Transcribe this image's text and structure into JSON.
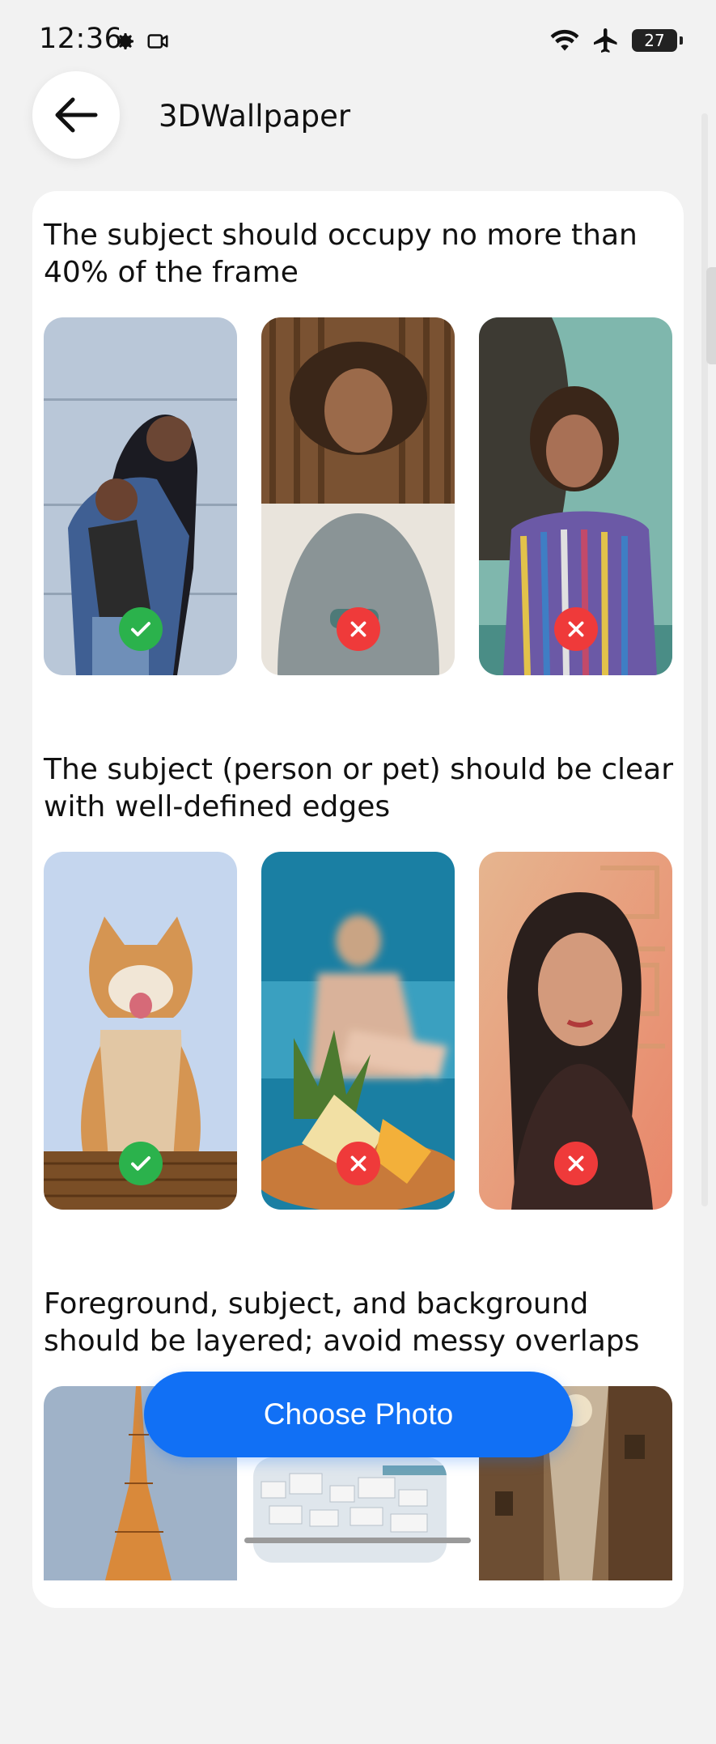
{
  "status_bar": {
    "time": "12:36",
    "battery": "27",
    "icons": [
      "gear-icon",
      "video-camera-icon",
      "wifi-icon",
      "airplane-icon",
      "battery-icon"
    ]
  },
  "header": {
    "title": "3DWallpaper",
    "back_icon": "arrow-left-icon"
  },
  "sections": [
    {
      "heading": "The subject should occupy no more than 40% of the frame",
      "examples": [
        {
          "photo": "mother and child hugging outdoors",
          "verdict": "good"
        },
        {
          "photo": "woman with curly hair in grey sweater",
          "verdict": "bad"
        },
        {
          "photo": "man in striped shirt against wall",
          "verdict": "bad"
        }
      ]
    },
    {
      "heading": "The subject (person or pet) should be clear with well-defined edges",
      "examples": [
        {
          "photo": "shiba inu dog on basket",
          "verdict": "good"
        },
        {
          "photo": "blurry person sitting behind pineapple",
          "verdict": "bad"
        },
        {
          "photo": "woman portrait with orange glow",
          "verdict": "bad"
        }
      ]
    },
    {
      "heading": "Foreground, subject, and background should be layered; avoid messy overlaps",
      "examples": [
        {
          "photo": "eiffel tower",
          "verdict": ""
        },
        {
          "photo": "whitewashed hillside town",
          "verdict": ""
        },
        {
          "photo": "narrow alley with buildings",
          "verdict": ""
        }
      ]
    }
  ],
  "actions": {
    "choose_photo": "Choose Photo"
  },
  "colors": {
    "accent": "#1170f5",
    "good": "#2bb24c",
    "bad": "#ef3a3a",
    "background": "#f2f2f2"
  }
}
